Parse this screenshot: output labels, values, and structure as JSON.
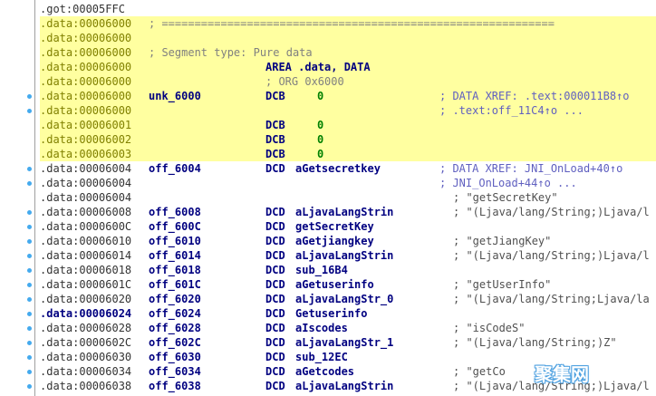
{
  "rows": [
    {
      "addr": ".got:00005FFC",
      "kind": "seg",
      "label": "",
      "op": "",
      "arg": "",
      "comment": "",
      "ctype": ""
    },
    {
      "addr": ".data:00006000",
      "kind": "rule",
      "label": "; ============================================================",
      "op": "",
      "arg": "",
      "comment": "",
      "ctype": ""
    },
    {
      "addr": ".data:00006000",
      "kind": "blank",
      "label": "",
      "op": "",
      "arg": "",
      "comment": "",
      "ctype": ""
    },
    {
      "addr": ".data:00006000",
      "kind": "seginfo",
      "label": "; Segment type: Pure data",
      "op": "",
      "arg": "",
      "comment": "",
      "ctype": ""
    },
    {
      "addr": ".data:00006000",
      "kind": "area",
      "label": "",
      "op": "AREA .data, DATA",
      "arg": "",
      "comment": "",
      "ctype": ""
    },
    {
      "addr": ".data:00006000",
      "kind": "org",
      "label": "",
      "op": "; ORG 0x6000",
      "arg": "",
      "comment": "",
      "ctype": ""
    },
    {
      "addr": ".data:00006000",
      "kind": "code",
      "label": "unk_6000",
      "op": "DCB",
      "arg": "0",
      "argnum": true,
      "comment": "; DATA XREF: .text:000011B8↑o",
      "ctype": "xref"
    },
    {
      "addr": ".data:00006000",
      "kind": "code",
      "label": "",
      "op": "",
      "arg": "",
      "comment": "; .text:off_11C4↑o ...",
      "ctype": "xref"
    },
    {
      "addr": ".data:00006001",
      "kind": "code",
      "label": "",
      "op": "DCB",
      "arg": "0",
      "argnum": true,
      "comment": "",
      "ctype": ""
    },
    {
      "addr": ".data:00006002",
      "kind": "code",
      "label": "",
      "op": "DCB",
      "arg": "0",
      "argnum": true,
      "comment": "",
      "ctype": ""
    },
    {
      "addr": ".data:00006003",
      "kind": "code",
      "label": "",
      "op": "DCB",
      "arg": "0",
      "argnum": true,
      "comment": "",
      "ctype": ""
    },
    {
      "addr": ".data:00006004",
      "kind": "code",
      "label": "off_6004",
      "op": "DCD",
      "arg": "aGetsecretkey",
      "comment": "; DATA XREF: JNI_OnLoad+40↑o",
      "ctype": "xref"
    },
    {
      "addr": ".data:00006004",
      "kind": "code",
      "label": "",
      "op": "",
      "arg": "",
      "comment": "; JNI_OnLoad+44↑o ...",
      "ctype": "xref"
    },
    {
      "addr": ".data:00006004",
      "kind": "code",
      "label": "",
      "op": "",
      "arg": "",
      "comment": "; \"getSecretKey\"",
      "ctype": "str"
    },
    {
      "addr": ".data:00006008",
      "kind": "code",
      "label": "off_6008",
      "op": "DCD",
      "arg": "aLjavaLangStrin",
      "comment": "; \"(Ljava/lang/String;)Ljava/l",
      "ctype": "str"
    },
    {
      "addr": ".data:0000600C",
      "kind": "code",
      "label": "off_600C",
      "op": "DCD",
      "arg": "getSecretKey",
      "comment": "",
      "ctype": ""
    },
    {
      "addr": ".data:00006010",
      "kind": "code",
      "label": "off_6010",
      "op": "DCD",
      "arg": "aGetjiangkey",
      "comment": "; \"getJiangKey\"",
      "ctype": "str"
    },
    {
      "addr": ".data:00006014",
      "kind": "code",
      "label": "off_6014",
      "op": "DCD",
      "arg": "aLjavaLangStrin",
      "comment": "; \"(Ljava/lang/String;)Ljava/l",
      "ctype": "str"
    },
    {
      "addr": ".data:00006018",
      "kind": "code",
      "label": "off_6018",
      "op": "DCD",
      "arg": "sub_16B4",
      "comment": "",
      "ctype": ""
    },
    {
      "addr": ".data:0000601C",
      "kind": "code",
      "label": "off_601C",
      "op": "DCD",
      "arg": "aGetuserinfo",
      "comment": "; \"getUserInfo\"",
      "ctype": "str"
    },
    {
      "addr": ".data:00006020",
      "kind": "code",
      "label": "off_6020",
      "op": "DCD",
      "arg": "aLjavaLangStr_0",
      "comment": "; \"(Ljava/lang/String;Ljava/la",
      "ctype": "str"
    },
    {
      "addr": ".data:00006024",
      "kind": "cur",
      "label": "off_6024",
      "op": "DCD",
      "arg": "Getuserinfo",
      "comment": "",
      "ctype": ""
    },
    {
      "addr": ".data:00006028",
      "kind": "code",
      "label": "off_6028",
      "op": "DCD",
      "arg": "aIscodes",
      "comment": "; \"isCodeS\"",
      "ctype": "str"
    },
    {
      "addr": ".data:0000602C",
      "kind": "code",
      "label": "off_602C",
      "op": "DCD",
      "arg": "aLjavaLangStr_1",
      "comment": "; \"(Ljava/lang/String;)Z\"",
      "ctype": "str"
    },
    {
      "addr": ".data:00006030",
      "kind": "code",
      "label": "off_6030",
      "op": "DCD",
      "arg": "sub_12EC",
      "comment": "",
      "ctype": ""
    },
    {
      "addr": ".data:00006034",
      "kind": "code",
      "label": "off_6034",
      "op": "DCD",
      "arg": "aGetcodes",
      "comment": "; \"getCo",
      "ctype": "str"
    },
    {
      "addr": ".data:00006038",
      "kind": "code",
      "label": "off_6038",
      "op": "DCD",
      "arg": "aLjavaLangStrin",
      "comment": "; \"(Ljava/lang/String;)Ljava/l",
      "ctype": "str"
    }
  ],
  "dots": [
    6,
    7,
    11,
    12,
    14,
    15,
    16,
    17,
    18,
    19,
    20,
    21,
    22,
    23,
    24,
    25,
    26
  ],
  "watermark": "聚集网",
  "colors": {
    "segment_address": "#808000",
    "name": "#000080",
    "xref_comment": "#6060c0",
    "string_comment": "#505050",
    "row_highlight": "#ffffa0",
    "breakpoint_dot": "#44aaee"
  }
}
